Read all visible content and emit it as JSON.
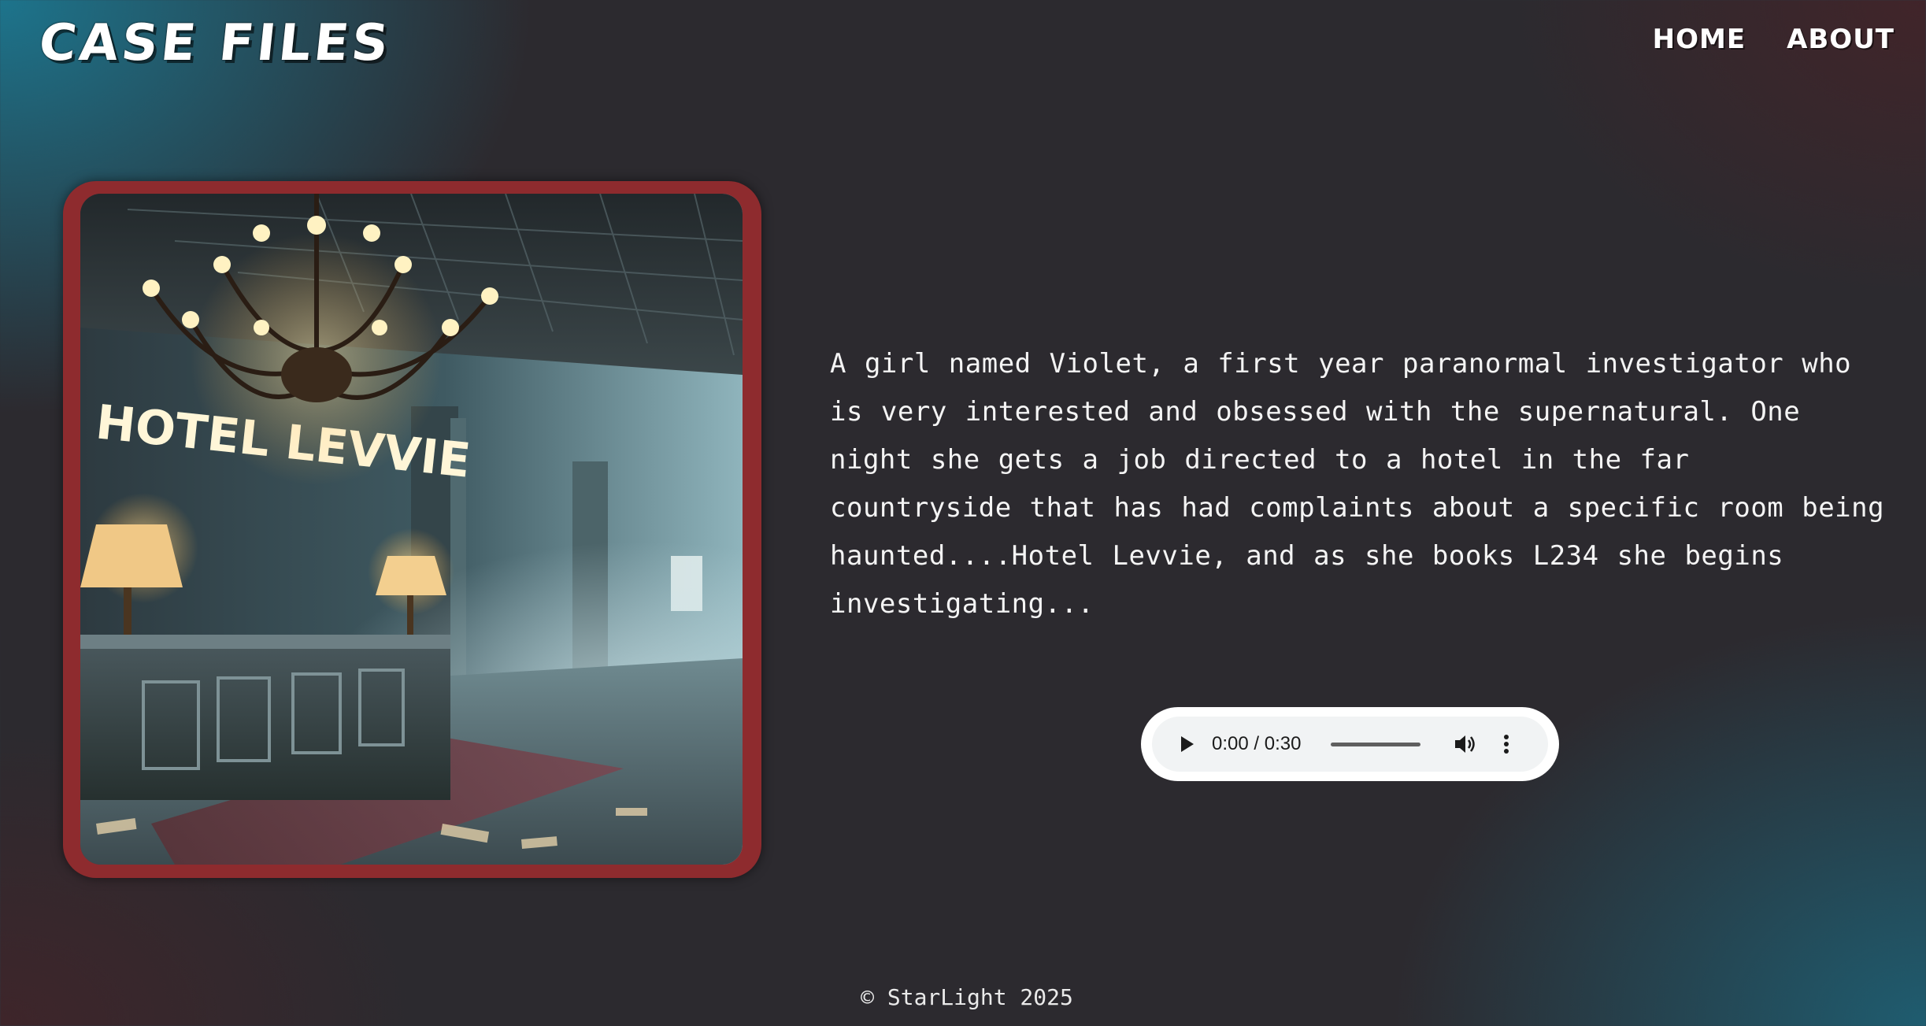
{
  "header": {
    "brand": "CASE FILES",
    "nav": [
      {
        "label": "HOME"
      },
      {
        "label": "ABOUT"
      }
    ]
  },
  "hero_image": {
    "sign_text": "HOTEL LEVVIE",
    "frame_color": "#8e2b2e"
  },
  "story": {
    "text": "A girl named Violet, a first year paranormal investigator who is very interested and obsessed with the supernatural. One night she gets a job directed to a hotel in the far countryside that has had complaints about a specific room being haunted....Hotel Levvie, and as she books L234 she begins investigating..."
  },
  "audio_player": {
    "time": "0:00 / 0:30",
    "progress": 0,
    "icons": [
      "play-icon",
      "volume-icon",
      "more-vert-icon"
    ]
  },
  "footer": {
    "text": "© StarLight 2025"
  },
  "colors": {
    "accent_teal": "#1c7891",
    "accent_maroon": "#8e2b2e",
    "background_dark": "#2c2a2f"
  }
}
